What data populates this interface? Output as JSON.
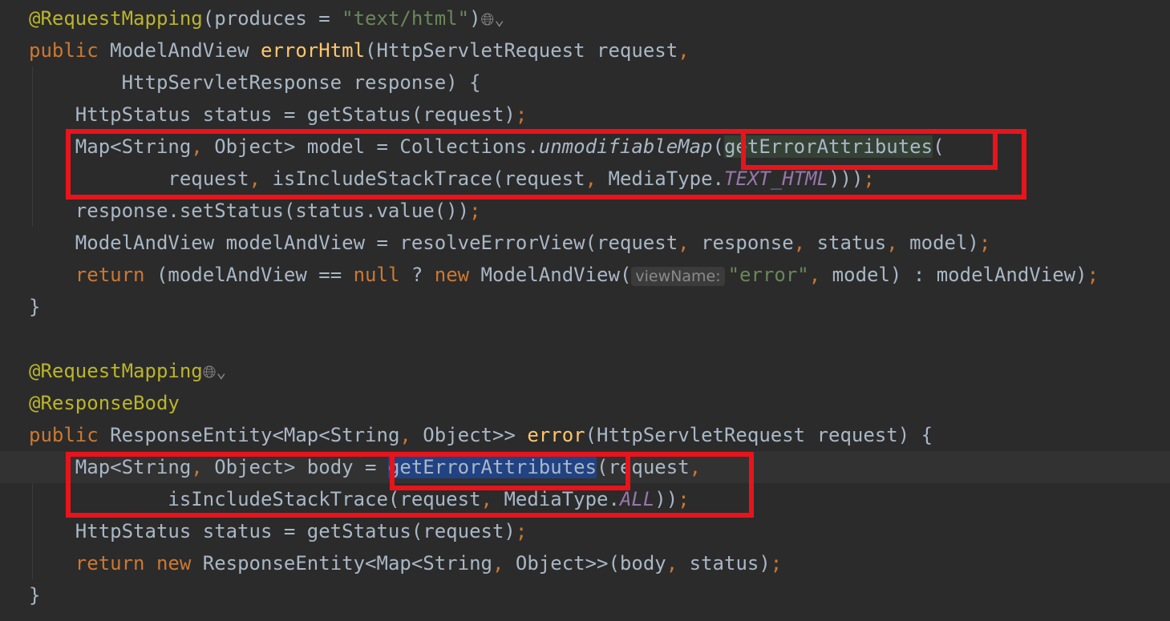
{
  "editor": {
    "lines": [
      {
        "tokens": [
          {
            "t": "@RequestMapping",
            "c": "ann"
          },
          {
            "t": "(produces = ",
            "c": "plain"
          },
          {
            "t": "\"text/html\"",
            "c": "str"
          },
          {
            "t": ")",
            "c": "plain"
          },
          {
            "t": "🌐︎⌄",
            "c": "icon",
            "name": "endpoint-globe-icon"
          }
        ]
      },
      {
        "tokens": [
          {
            "t": "public ",
            "c": "kw"
          },
          {
            "t": "ModelAndView ",
            "c": "plain"
          },
          {
            "t": "errorHtml",
            "c": "fn"
          },
          {
            "t": "(HttpServletRequest request",
            "c": "plain"
          },
          {
            "t": ",",
            "c": "punct"
          }
        ]
      },
      {
        "tokens": [
          {
            "t": "        HttpServletResponse response) {",
            "c": "plain"
          }
        ]
      },
      {
        "tokens": [
          {
            "t": "    HttpStatus status = getStatus(request)",
            "c": "plain"
          },
          {
            "t": ";",
            "c": "punct"
          }
        ]
      },
      {
        "tokens": [
          {
            "t": "    Map<String",
            "c": "plain"
          },
          {
            "t": ", ",
            "c": "punct"
          },
          {
            "t": "Object> model = Collections.",
            "c": "plain"
          },
          {
            "t": "unmodifiableMap",
            "c": "italic"
          },
          {
            "t": "(",
            "c": "plain"
          },
          {
            "t": "getErrorAttributes",
            "c": "plain",
            "hl": "green"
          },
          {
            "t": "(",
            "c": "plain"
          }
        ]
      },
      {
        "tokens": [
          {
            "t": "            request",
            "c": "plain"
          },
          {
            "t": ", ",
            "c": "punct"
          },
          {
            "t": "isIncludeStackTrace(request",
            "c": "plain"
          },
          {
            "t": ", ",
            "c": "punct"
          },
          {
            "t": "MediaType.",
            "c": "plain"
          },
          {
            "t": "TEXT_HTML",
            "c": "const"
          },
          {
            "t": ")))",
            "c": "plain"
          },
          {
            "t": ";",
            "c": "punct"
          }
        ]
      },
      {
        "tokens": [
          {
            "t": "    response.setStatus(status.value())",
            "c": "plain"
          },
          {
            "t": ";",
            "c": "punct"
          }
        ]
      },
      {
        "tokens": [
          {
            "t": "    ModelAndView modelAndView = resolveErrorView(request",
            "c": "plain"
          },
          {
            "t": ", ",
            "c": "punct"
          },
          {
            "t": "response",
            "c": "plain"
          },
          {
            "t": ", ",
            "c": "punct"
          },
          {
            "t": "status",
            "c": "plain"
          },
          {
            "t": ", ",
            "c": "punct"
          },
          {
            "t": "model)",
            "c": "plain"
          },
          {
            "t": ";",
            "c": "punct"
          }
        ]
      },
      {
        "tokens": [
          {
            "t": "    return ",
            "c": "kw"
          },
          {
            "t": "(modelAndView == ",
            "c": "plain"
          },
          {
            "t": "null ",
            "c": "kw"
          },
          {
            "t": "? ",
            "c": "plain"
          },
          {
            "t": "new ",
            "c": "kw"
          },
          {
            "t": "ModelAndView(",
            "c": "plain"
          },
          {
            "t": "viewName:",
            "c": "hint"
          },
          {
            "t": "\"error\"",
            "c": "str"
          },
          {
            "t": ", ",
            "c": "punct"
          },
          {
            "t": "model) : modelAndView)",
            "c": "plain"
          },
          {
            "t": ";",
            "c": "punct"
          }
        ]
      },
      {
        "tokens": [
          {
            "t": "}",
            "c": "plain"
          }
        ]
      },
      {
        "tokens": []
      },
      {
        "tokens": [
          {
            "t": "@RequestMapping",
            "c": "ann"
          },
          {
            "t": "🌐︎⌄",
            "c": "icon",
            "name": "endpoint-globe-icon"
          }
        ]
      },
      {
        "tokens": [
          {
            "t": "@ResponseBody",
            "c": "ann"
          }
        ]
      },
      {
        "tokens": [
          {
            "t": "public ",
            "c": "kw"
          },
          {
            "t": "ResponseEntity<Map<String",
            "c": "plain"
          },
          {
            "t": ", ",
            "c": "punct"
          },
          {
            "t": "Object>> ",
            "c": "plain"
          },
          {
            "t": "error",
            "c": "fn"
          },
          {
            "t": "(HttpServletRequest request) {",
            "c": "plain"
          }
        ]
      },
      {
        "current": true,
        "tokens": [
          {
            "t": "    Map<String",
            "c": "plain"
          },
          {
            "t": ", ",
            "c": "punct"
          },
          {
            "t": "Object> body = ",
            "c": "plain"
          },
          {
            "t": "getErrorAttributes",
            "c": "plain",
            "hl": "blue"
          },
          {
            "t": "(request",
            "c": "plain"
          },
          {
            "t": ",",
            "c": "punct"
          }
        ]
      },
      {
        "tokens": [
          {
            "t": "            isIncludeStackTrace(request",
            "c": "plain"
          },
          {
            "t": ", ",
            "c": "punct"
          },
          {
            "t": "MediaType.",
            "c": "plain"
          },
          {
            "t": "ALL",
            "c": "const"
          },
          {
            "t": "))",
            "c": "plain"
          },
          {
            "t": ";",
            "c": "punct"
          }
        ]
      },
      {
        "tokens": [
          {
            "t": "    HttpStatus status = getStatus(request)",
            "c": "plain"
          },
          {
            "t": ";",
            "c": "punct"
          }
        ]
      },
      {
        "tokens": [
          {
            "t": "    return ",
            "c": "kw"
          },
          {
            "t": "new ",
            "c": "kw"
          },
          {
            "t": "ResponseEntity<Map<String",
            "c": "plain"
          },
          {
            "t": ", ",
            "c": "punct"
          },
          {
            "t": "Object>>(body",
            "c": "plain"
          },
          {
            "t": ", ",
            "c": "punct"
          },
          {
            "t": "status)",
            "c": "plain"
          },
          {
            "t": ";",
            "c": "punct"
          }
        ]
      },
      {
        "tokens": [
          {
            "t": "}",
            "c": "plain"
          }
        ]
      }
    ]
  },
  "colors": {
    "background": "#2b2b2b",
    "annotation": "#bbb529",
    "keyword": "#cc7832",
    "string": "#6a8759",
    "method": "#ffc66d",
    "constant": "#9876aa",
    "highlight_box": "#e8141c",
    "highlight_green": "#344134",
    "highlight_blue": "#214283"
  }
}
